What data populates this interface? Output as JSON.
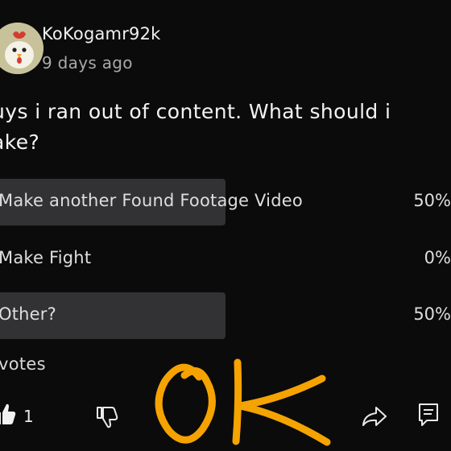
{
  "post": {
    "author": "KoKogamr92k",
    "time": "9 days ago",
    "text": "uys i ran out of content. What should i\nake?"
  },
  "poll": {
    "options": [
      {
        "label": "Make another Found Footage Video",
        "percent": "50%",
        "fraction": 0.5
      },
      {
        "label": "Make Fight",
        "percent": "0%",
        "fraction": 0
      },
      {
        "label": "Other?",
        "percent": "50%",
        "fraction": 0.5
      }
    ],
    "votes": "votes"
  },
  "actions": {
    "like_count": "1",
    "like_icon": "thumbs-up-icon",
    "dislike_icon": "thumbs-down-icon",
    "share_icon": "share-icon",
    "comment_icon": "comment-icon"
  },
  "overlay": {
    "scribble": "OK",
    "color": "#f5a300"
  }
}
